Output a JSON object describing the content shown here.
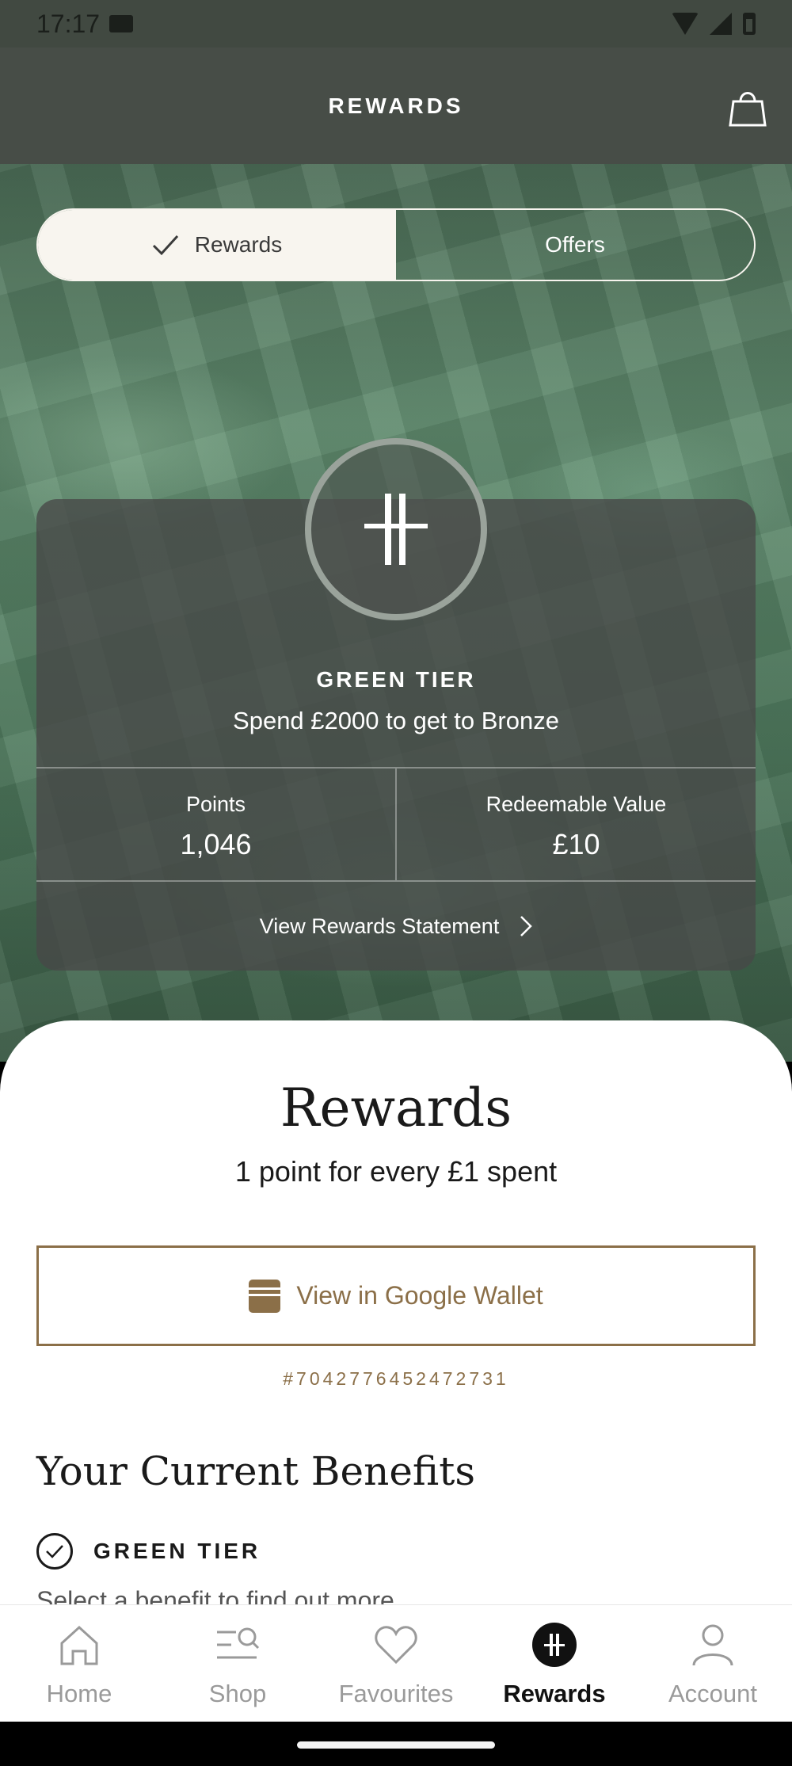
{
  "status_bar": {
    "time": "17:17"
  },
  "header": {
    "title": "REWARDS",
    "bag_icon": "shopping-bag-icon"
  },
  "segment": {
    "tabs": [
      {
        "label": "Rewards",
        "active": true
      },
      {
        "label": "Offers",
        "active": false
      }
    ]
  },
  "tier_card": {
    "tier_name": "GREEN TIER",
    "progress_text": "Spend £2000 to get to Bronze",
    "points_label": "Points",
    "points_value": "1,046",
    "redeemable_label": "Redeemable Value",
    "redeemable_value": "£10",
    "statement_link": "View Rewards Statement"
  },
  "rewards_section": {
    "title": "Rewards",
    "subtitle": "1 point for every £1 spent",
    "wallet_button": "View in Google Wallet",
    "card_number": "#7042776452472731"
  },
  "benefits": {
    "title": "Your Current Benefits",
    "tier_label": "GREEN TIER",
    "hint": "Select a benefit to find out more"
  },
  "bottom_nav": {
    "items": [
      {
        "label": "Home",
        "icon": "home-icon",
        "active": false
      },
      {
        "label": "Shop",
        "icon": "shop-search-icon",
        "active": false
      },
      {
        "label": "Favourites",
        "icon": "heart-icon",
        "active": false
      },
      {
        "label": "Rewards",
        "icon": "rewards-logo-icon",
        "active": true
      },
      {
        "label": "Account",
        "icon": "person-icon",
        "active": false
      }
    ]
  },
  "colors": {
    "accent_gold": "#8b6f48",
    "header_bg": "#474d47",
    "active_tab_bg": "#f8f5ef"
  }
}
